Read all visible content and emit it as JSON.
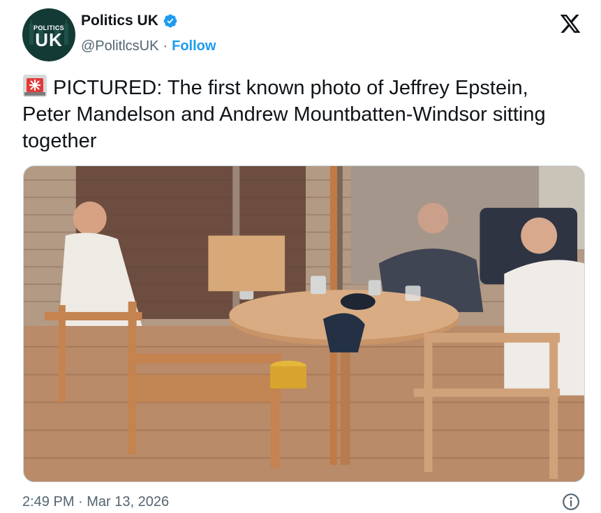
{
  "account": {
    "name": "Politics UK",
    "handle": "@PolitlcsUK",
    "separator": "·",
    "follow_label": "Follow",
    "avatar_line1": "POLITICS",
    "avatar_line2": "UK",
    "verified": true
  },
  "tweet": {
    "emoji_icon": "rotating-light-icon",
    "text": "PICTURED: The first known photo of Jeffrey Epstein, Peter Mandelson and Andrew Mountbatten-Windsor sitting together"
  },
  "footer": {
    "timestamp": "2:49 PM · Mar 13, 2026"
  },
  "colors": {
    "accent": "#1d9bf0",
    "text": "#0f1419",
    "muted": "#536471",
    "avatar_bg": "#143a36"
  },
  "icons": [
    "verified-badge-icon",
    "x-logo-icon",
    "rotating-light-icon",
    "info-icon"
  ]
}
